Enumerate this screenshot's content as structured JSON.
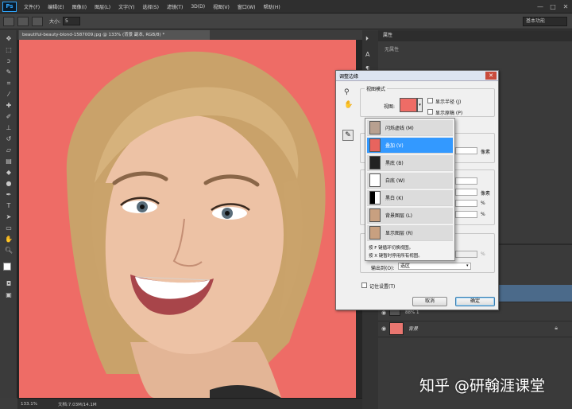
{
  "app": {
    "logo": "Ps"
  },
  "menu": [
    "文件(F)",
    "编辑(E)",
    "图像(I)",
    "图层(L)",
    "文字(Y)",
    "选择(S)",
    "滤镜(T)",
    "3D(D)",
    "视图(V)",
    "窗口(W)",
    "帮助(H)"
  ],
  "window_controls": [
    "—",
    "□",
    "✕"
  ],
  "options_bar": {
    "size_label": "大小:",
    "size_value": "5",
    "workspace": "基本功能"
  },
  "document": {
    "tab_title": "beautiful-beauty-blond-1587009.jpg @ 133% (背景 副本, RGB/8) *",
    "zoom": "133.1%",
    "doc_info": "文档:7.03M/14.1M"
  },
  "right_panel": {
    "tab": "属性",
    "subtitle": "无属性"
  },
  "layers": [
    {
      "name": "",
      "visible": true
    },
    {
      "name": "88% 1",
      "visible": true
    },
    {
      "name": "背景",
      "visible": true,
      "locked": true
    }
  ],
  "dialog": {
    "title": "调整边缘",
    "view_mode_group": "视图模式",
    "view_label": "视图:",
    "show_radius": "显示半径 (J)",
    "show_original": "显示原稿 (P)",
    "unit_px": "像素",
    "unit_pct": "%",
    "output_to_label": "输出到(O):",
    "output_to_value": "选区",
    "remember": "记住设置(T)",
    "cancel": "取消",
    "ok": "确定"
  },
  "view_menu": {
    "items": [
      {
        "label": "闪烁虚线 (M)",
        "selected": false
      },
      {
        "label": "叠加 (V)",
        "selected": true
      },
      {
        "label": "黑底 (B)",
        "selected": false
      },
      {
        "label": "白底 (W)",
        "selected": false
      },
      {
        "label": "黑白 (K)",
        "selected": false
      },
      {
        "label": "背景图层 (L)",
        "selected": false
      },
      {
        "label": "显示图层 (R)",
        "selected": false
      }
    ],
    "hint1": "按 F 键循环切换视图。",
    "hint2": "按 X 键暂时停用所有视图。"
  },
  "watermark": "知乎 @研翰涯课堂",
  "colors": {
    "canvas_bg": "#ee6c66",
    "highlight": "#3399ff"
  }
}
